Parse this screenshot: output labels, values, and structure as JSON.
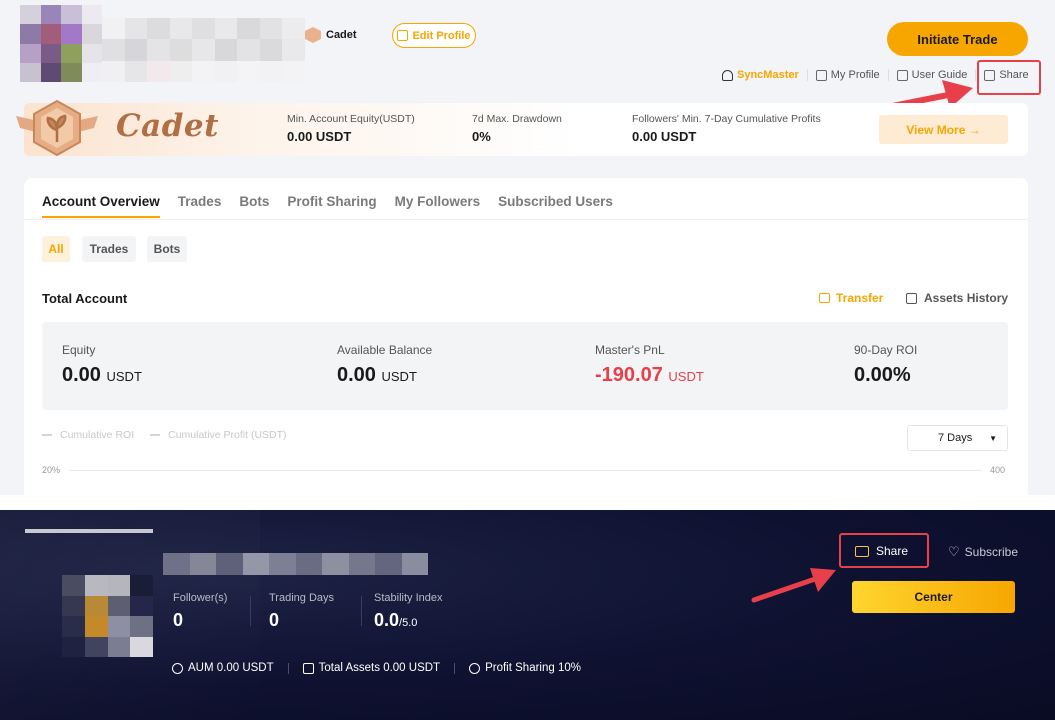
{
  "top": {
    "level_badge": "Cadet",
    "edit_profile": "Edit Profile",
    "initiate_trade": "Initiate Trade",
    "links": {
      "syncmaster": "SyncMaster",
      "my_profile": "My Profile",
      "user_guide": "User Guide",
      "share": "Share"
    },
    "banner": {
      "level_name": "Cadet",
      "stats": [
        {
          "label": "Min. Account Equity(USDT)",
          "value": "0.00 USDT"
        },
        {
          "label": "7d Max. Drawdown",
          "value": "0%"
        },
        {
          "label": "Followers' Min. 7-Day Cumulative Profits",
          "value": "0.00 USDT"
        }
      ],
      "view_more": "View More →"
    },
    "tabs": [
      "Account Overview",
      "Trades",
      "Bots",
      "Profit Sharing",
      "My Followers",
      "Subscribed Users"
    ],
    "subtabs": [
      "All",
      "Trades",
      "Bots"
    ],
    "total_account": "Total Account",
    "transfer": "Transfer",
    "assets_history": "Assets History",
    "summary": [
      {
        "label": "Equity",
        "value": "0.00",
        "unit": "USDT"
      },
      {
        "label": "Available Balance",
        "value": "0.00",
        "unit": "USDT"
      },
      {
        "label": "Master's PnL",
        "value": "-190.07",
        "unit": "USDT"
      },
      {
        "label": "90-Day ROI",
        "value": "0.00%",
        "unit": ""
      }
    ],
    "legend": [
      "Cumulative ROI",
      "Cumulative Profit (USDT)"
    ],
    "period": "7 Days",
    "axis_left": "20%",
    "axis_right": "400"
  },
  "bottom": {
    "stats": [
      {
        "label": "Follower(s)",
        "value": "0"
      },
      {
        "label": "Trading Days",
        "value": "0"
      },
      {
        "label": "Stability Index",
        "value": "0.0",
        "suffix": "/5.0"
      }
    ],
    "aum": "AUM 0.00 USDT",
    "total_assets": "Total Assets 0.00 USDT",
    "profit_sharing": "Profit Sharing 10%",
    "share": "Share",
    "subscribe": "Subscribe",
    "center": "Center"
  },
  "colors": {
    "accent": "#f7a600",
    "highlight": "#e8404a",
    "loss": "#e8404a",
    "dark_bg": "#0e1130"
  }
}
